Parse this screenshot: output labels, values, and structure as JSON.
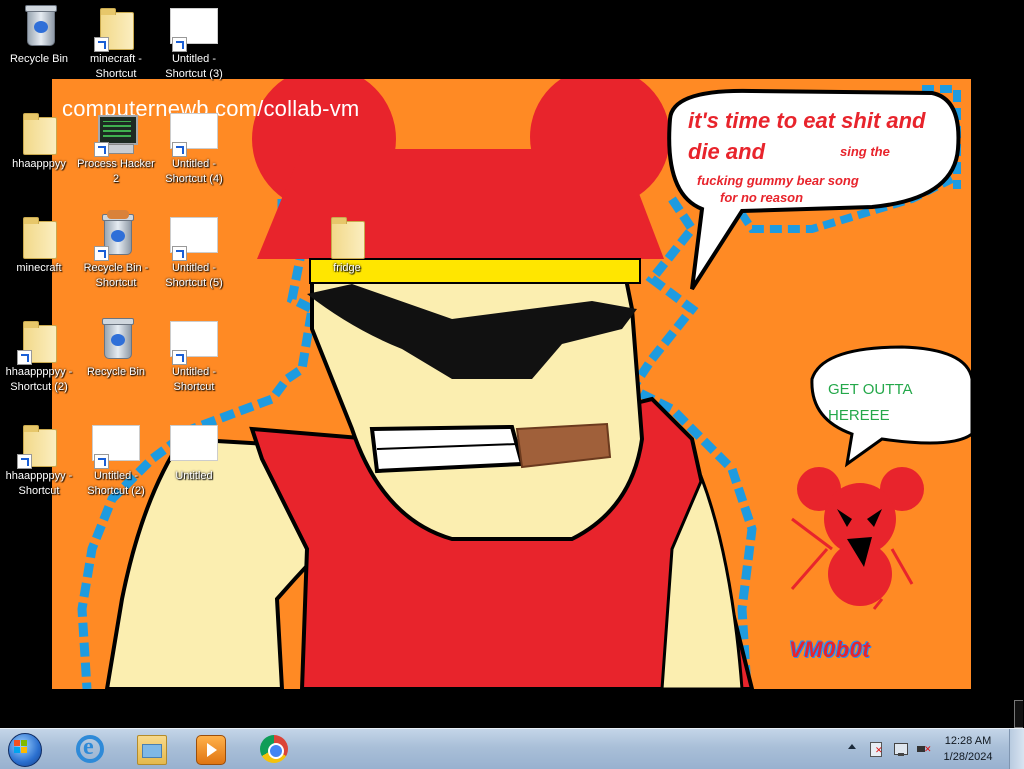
{
  "wallpaper": {
    "watermark": "computernewb.com/collab-vm",
    "speech_main": "it's time to eat shit and die and",
    "speech_small_1": "sing the",
    "speech_small_2": "fucking gummy bear song",
    "speech_small_3": "for no reason",
    "speech_secondary": "GET OUTTA HEREEE",
    "signature": "VM0b0t",
    "colors": {
      "background": "#ff8a24",
      "accent_red": "#e8242c",
      "accent_blue": "#1e9be0",
      "skin": "#fbeeb0"
    }
  },
  "desktop_icons": [
    {
      "id": "recycle-bin",
      "label": "Recycle Bin",
      "icon": "recycle-bin-empty-icon",
      "shortcut": false
    },
    {
      "id": "minecraft-shortcut",
      "label": "minecraft - Shortcut",
      "icon": "folder-icon",
      "shortcut": true
    },
    {
      "id": "untitled-shortcut-3",
      "label": "Untitled - Shortcut (3)",
      "icon": "paint-file-icon",
      "shortcut": true
    },
    {
      "id": "hhaapppyy",
      "label": "hhaapppyy",
      "icon": "folder-icon",
      "shortcut": false
    },
    {
      "id": "process-hacker-2",
      "label": "Process Hacker 2",
      "icon": "process-hacker-icon",
      "shortcut": true
    },
    {
      "id": "untitled-shortcut-4",
      "label": "Untitled - Shortcut (4)",
      "icon": "paint-file-icon",
      "shortcut": true
    },
    {
      "id": "fridge",
      "label": "fridge",
      "icon": "folder-icon",
      "shortcut": false
    },
    {
      "id": "minecraft",
      "label": "minecraft",
      "icon": "folder-icon",
      "shortcut": false
    },
    {
      "id": "recycle-bin-shortcut",
      "label": "Recycle Bin - Shortcut",
      "icon": "recycle-bin-full-icon",
      "shortcut": true
    },
    {
      "id": "untitled-shortcut-5",
      "label": "Untitled - Shortcut (5)",
      "icon": "paint-file-icon",
      "shortcut": true
    },
    {
      "id": "hhaapppyy-shortcut-2",
      "label": "hhaappppyy - Shortcut (2)",
      "icon": "folder-icon",
      "shortcut": true
    },
    {
      "id": "recycle-bin-2",
      "label": "Recycle Bin",
      "icon": "recycle-bin-empty-icon",
      "shortcut": false
    },
    {
      "id": "untitled-shortcut",
      "label": "Untitled - Shortcut",
      "icon": "paint-file-icon",
      "shortcut": true
    },
    {
      "id": "hhaapppyy-shortcut",
      "label": "hhaappppyy - Shortcut",
      "icon": "folder-icon",
      "shortcut": true
    },
    {
      "id": "untitled-shortcut-2",
      "label": "Untitled - Shortcut (2)",
      "icon": "paint-file-icon",
      "shortcut": true
    },
    {
      "id": "untitled",
      "label": "Untitled",
      "icon": "paint-file-icon",
      "shortcut": false
    }
  ],
  "taskbar": {
    "pinned": [
      {
        "name": "Internet Explorer",
        "icon": "internet-explorer-icon"
      },
      {
        "name": "Windows Explorer",
        "icon": "file-explorer-icon"
      },
      {
        "name": "Windows Media Player",
        "icon": "media-player-icon"
      },
      {
        "name": "Google Chrome",
        "icon": "chrome-icon"
      }
    ],
    "tray": {
      "time": "12:28 AM",
      "date": "1/28/2024",
      "icons": [
        "show-hidden-icons-icon",
        "action-center-flag-icon",
        "network-icon",
        "volume-muted-icon"
      ]
    }
  }
}
